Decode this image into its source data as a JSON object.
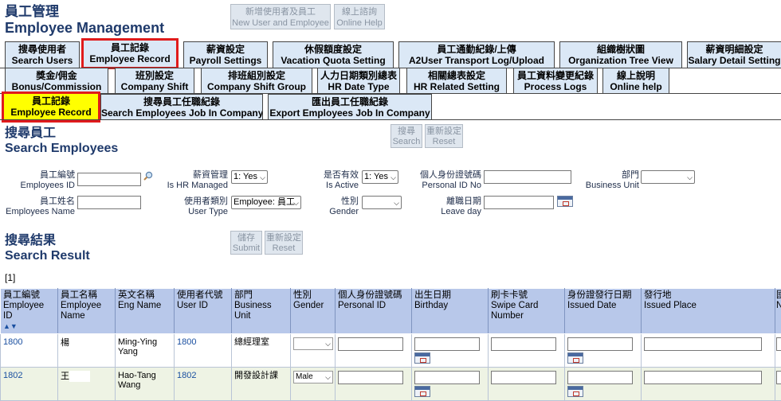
{
  "header": {
    "title_zh": "員工管理",
    "title_en": "Employee Management",
    "new_user_btn": [
      "新增使用者及員工",
      "New User and Employee"
    ],
    "online_help_btn": [
      "線上諮詢",
      "Online Help"
    ]
  },
  "tabs_row1": [
    {
      "zh": "搜尋使用者",
      "en": "Search Users"
    },
    {
      "zh": "員工記錄",
      "en": "Employee Record"
    },
    {
      "zh": "薪資設定",
      "en": "Payroll Settings"
    },
    {
      "zh": "休假額度設定",
      "en": "Vacation Quota Setting"
    },
    {
      "zh": "員工通勤紀錄/上傳",
      "en": "A2User Transport Log/Upload"
    },
    {
      "zh": "組織樹狀圖",
      "en": "Organization Tree View"
    },
    {
      "zh": "薪資明細設定",
      "en": "Salary Detail Setting"
    }
  ],
  "tabs_row2": [
    {
      "zh": "獎金/佣金",
      "en": "Bonus/Commission"
    },
    {
      "zh": "班別設定",
      "en": "Company Shift"
    },
    {
      "zh": "排班組別設定",
      "en": "Company Shift Group"
    },
    {
      "zh": "人力日期類別總表",
      "en": "HR Date Type"
    },
    {
      "zh": "相關總表設定",
      "en": "HR Related Setting"
    },
    {
      "zh": "員工資料變更紀錄",
      "en": "Process Logs"
    },
    {
      "zh": "線上說明",
      "en": "Online help"
    }
  ],
  "tabs_row3": [
    {
      "zh": "員工記錄",
      "en": "Employee Record"
    },
    {
      "zh": "搜尋員工任職紀錄",
      "en": "Search Employees Job In Company"
    },
    {
      "zh": "匯出員工任職紀錄",
      "en": "Export Employees Job In Company"
    }
  ],
  "search": {
    "title_zh": "搜尋員工",
    "title_en": "Search Employees",
    "search_btn": [
      "搜尋",
      "Search"
    ],
    "reset_btn": [
      "重新設定",
      "Reset"
    ],
    "fields": {
      "employee_id": [
        "員工編號",
        "Employees ID"
      ],
      "employee_name": [
        "員工姓名",
        "Employees Name"
      ],
      "is_hr": [
        "薪資管理",
        "Is HR Managed"
      ],
      "is_hr_value": "1: Yes",
      "user_type": [
        "使用者類別",
        "User Type"
      ],
      "user_type_value": "Employee: 員工",
      "is_active": [
        "是否有效",
        "Is Active"
      ],
      "is_active_value": "1: Yes",
      "gender": [
        "性別",
        "Gender"
      ],
      "gender_value": "",
      "personal_id": [
        "個人身份證號碼",
        "Personal ID No"
      ],
      "leave_day": [
        "離職日期",
        "Leave day"
      ],
      "business_unit": [
        "部門",
        "Business Unit"
      ],
      "business_unit_value": ""
    }
  },
  "result": {
    "title_zh": "搜尋結果",
    "title_en": "Search Result",
    "save_btn": [
      "儲存",
      "Submit"
    ],
    "reset_btn": [
      "重新設定",
      "Reset"
    ],
    "pager": "[1]",
    "columns": [
      [
        "員工編號",
        "Employee ID"
      ],
      [
        "員工名稱",
        "Employee Name"
      ],
      [
        "英文名稱",
        "Eng Name"
      ],
      [
        "使用者代號",
        "User ID"
      ],
      [
        "部門",
        "Business Unit"
      ],
      [
        "性別",
        "Gender"
      ],
      [
        "個人身份證號碼",
        "Personal ID"
      ],
      [
        "出生日期",
        "Birthday"
      ],
      [
        "刷卡卡號",
        "Swipe Card Number"
      ],
      [
        "身份證發行日期",
        "Issued Date"
      ],
      [
        "發行地",
        "Issued Place"
      ],
      [
        "國",
        "N"
      ]
    ],
    "sort_icons": "▲▼",
    "rows": [
      {
        "id": "1800",
        "name": "楊",
        "eng": "Ming-Ying Yang",
        "user": "1800",
        "unit": "總經理室",
        "gender": ""
      },
      {
        "id": "1802",
        "name": "王",
        "eng": "Hao-Tang Wang",
        "user": "1802",
        "unit": "開發設計課",
        "gender": "Male"
      }
    ]
  }
}
